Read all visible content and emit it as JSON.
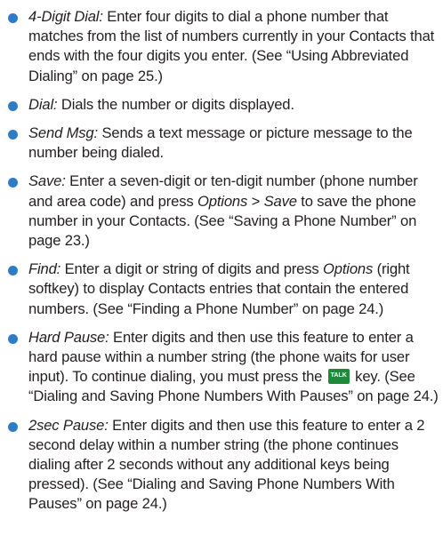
{
  "items": [
    {
      "term": "4-Digit Dial:",
      "text": " Enter four digits to dial a phone number that matches from the list of numbers currently in your Contacts that ends with the four digits you enter. (See “Using Abbreviated Dialing” on page 25.)"
    },
    {
      "term": "Dial:",
      "text": " Dials the number or digits displayed."
    },
    {
      "term": "Send Msg:",
      "text": " Sends a text message or picture message to the number being dialed."
    },
    {
      "term": "Save:",
      "text_a": " Enter a seven-digit or ten-digit number (phone number and area code) and press ",
      "options": "Options",
      "sep": " > ",
      "save": "Save",
      "text_b": " to save the phone number in your Contacts. (See “Saving a Phone Number” on page 23.)"
    },
    {
      "term": "Find:",
      "text_a": " Enter a digit or string of digits and press ",
      "options": "Options",
      "text_b": " (right softkey) to display Contacts entries that contain the entered numbers. (See “Finding a Phone Number” on page 24.)"
    },
    {
      "term": "Hard Pause:",
      "text_a": " Enter digits and then use this feature to enter a hard pause within a number string (the phone waits for user input). To continue dialing, you must press the ",
      "key_label": "TALK",
      "text_b": " key. (See “Dialing and Saving Phone Numbers With Pauses” on page 24.)"
    },
    {
      "term": "2sec Pause:",
      "text": " Enter digits and then use this feature to enter a 2 second delay within a number string (the phone continues dialing after 2 seconds without any additional keys being pressed). (See “Dialing and Saving Phone Numbers With Pauses” on page 24.)"
    }
  ],
  "colors": {
    "bullet": "#2e7bc6",
    "talk_key": "#1e8a3a",
    "text": "#231f20"
  },
  "icons": {
    "bullet": "bullet-dot-icon",
    "talk_key": "talk-key-icon"
  }
}
